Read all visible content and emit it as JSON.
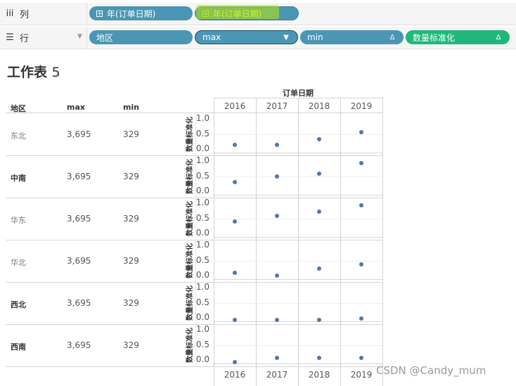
{
  "columns_shelf": {
    "icon": "columns-icon",
    "label": "列",
    "pills": [
      {
        "text": "年(订单日期)",
        "color": "#4a96b4"
      },
      {
        "text": "年(订单日期)",
        "color": "#4a96b4",
        "highlight": "#c9e80e"
      }
    ]
  },
  "rows_shelf": {
    "icon": "rows-icon",
    "label": "行",
    "pills": [
      {
        "text": "地区",
        "end": ""
      },
      {
        "text": "max",
        "end": "▼"
      },
      {
        "text": "min",
        "end": "Δ"
      },
      {
        "text": "数量标准化",
        "end": "Δ"
      }
    ]
  },
  "sheet": {
    "title": "工作表",
    "number": "5"
  },
  "table": {
    "column_header_title": "订单日期",
    "headers": [
      "地区",
      "max",
      "min"
    ],
    "years": [
      "2016",
      "2017",
      "2018",
      "2019"
    ],
    "axis_title": "数量标准化",
    "axis_ticks": [
      "1.0",
      "0.5",
      "0.0"
    ],
    "rows": [
      {
        "region": "东北",
        "max": "3,695",
        "min": "329",
        "values": [
          0.2,
          0.22,
          0.4,
          0.63
        ]
      },
      {
        "region": "中南",
        "max": "3,695",
        "min": "329",
        "values": [
          0.37,
          0.55,
          0.64,
          1.0
        ]
      },
      {
        "region": "华东",
        "max": "3,695",
        "min": "329",
        "values": [
          0.46,
          0.64,
          0.8,
          1.0
        ]
      },
      {
        "region": "华北",
        "max": "3,695",
        "min": "329",
        "values": [
          0.16,
          0.08,
          0.3,
          0.44
        ]
      },
      {
        "region": "西北",
        "max": "3,695",
        "min": "329",
        "values": [
          0.0,
          0.0,
          0.0,
          0.05
        ]
      },
      {
        "region": "西南",
        "max": "3,695",
        "min": "329",
        "values": [
          0.0,
          0.15,
          0.15,
          0.15
        ]
      }
    ]
  },
  "watermark": "CSDN @Candy_mum",
  "colors": {
    "pill_blue": "#4a96b4",
    "pill_green": "#1fb87a",
    "mark": "#4f78a8"
  }
}
